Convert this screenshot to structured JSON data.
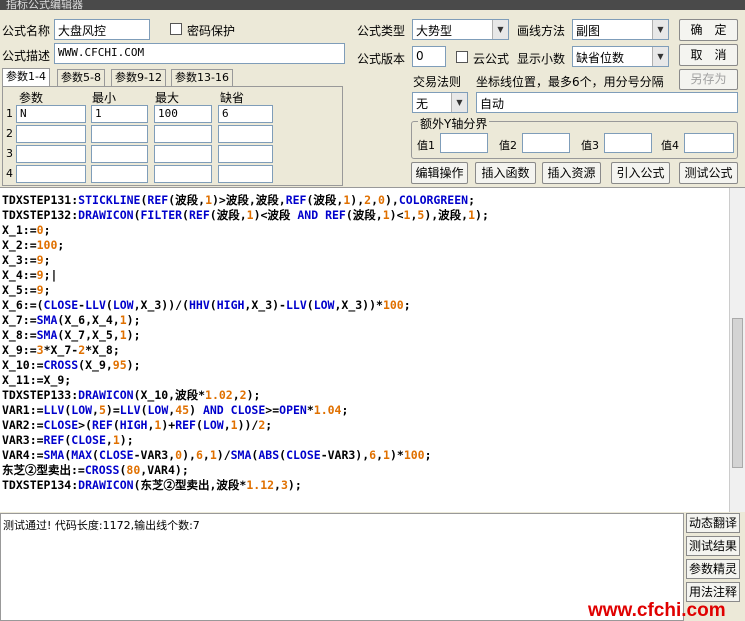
{
  "window": {
    "title": "指标公式编辑器"
  },
  "form": {
    "name_label": "公式名称",
    "name_value": "大盘风控",
    "password_label": "密码保护",
    "type_label": "公式类型",
    "type_value": "大势型",
    "draw_label": "画线方法",
    "draw_value": "副图",
    "desc_label": "公式描述",
    "desc_value": "WWW.CFCHI.COM",
    "version_label": "公式版本",
    "version_value": "0",
    "cloud_label": "云公式",
    "decimal_label": "显示小数",
    "decimal_value": "缺省位数",
    "trade_rule_label": "交易法则",
    "trade_rule_value": "无",
    "axis_label": "坐标线位置，最多6个，用分号分隔",
    "axis_value": "自动",
    "y_axis_group": "额外Y轴分界",
    "y_values": [
      "值1",
      "值2",
      "值3",
      "值4"
    ]
  },
  "buttons": {
    "ok": "确　定",
    "cancel": "取　消",
    "save_as": "另存为",
    "edit": "编辑操作",
    "insert_func": "插入函数",
    "insert_res": "插入资源",
    "import": "引入公式",
    "test": "测试公式"
  },
  "tabs": [
    "参数1-4",
    "参数5-8",
    "参数9-12",
    "参数13-16"
  ],
  "params": {
    "headers": [
      "参数",
      "最小",
      "最大",
      "缺省"
    ],
    "rows": [
      {
        "num": "1",
        "name": "N",
        "min": "1",
        "max": "100",
        "def": "6"
      },
      {
        "num": "2",
        "name": "",
        "min": "",
        "max": "",
        "def": ""
      },
      {
        "num": "3",
        "name": "",
        "min": "",
        "max": "",
        "def": ""
      },
      {
        "num": "4",
        "name": "",
        "min": "",
        "max": "",
        "def": ""
      }
    ]
  },
  "code_lines": [
    [
      [
        "TDXSTEP131:",
        "k"
      ],
      [
        "STICKLINE",
        "f"
      ],
      [
        "(",
        "k"
      ],
      [
        "REF",
        "f"
      ],
      [
        "(波段,",
        "k"
      ],
      [
        "1",
        "n"
      ],
      [
        ")>波段,波段,",
        "k"
      ],
      [
        "REF",
        "f"
      ],
      [
        "(波段,",
        "k"
      ],
      [
        "1",
        "n"
      ],
      [
        "),",
        "k"
      ],
      [
        "2",
        "n"
      ],
      [
        ",",
        "k"
      ],
      [
        "0",
        "n"
      ],
      [
        "),",
        "k"
      ],
      [
        "COLORGREEN",
        "f"
      ],
      [
        ";",
        "k"
      ]
    ],
    [
      [
        "TDXSTEP132:",
        "k"
      ],
      [
        "DRAWICON",
        "f"
      ],
      [
        "(",
        "k"
      ],
      [
        "FILTER",
        "f"
      ],
      [
        "(",
        "k"
      ],
      [
        "REF",
        "f"
      ],
      [
        "(波段,",
        "k"
      ],
      [
        "1",
        "n"
      ],
      [
        ")<波段 ",
        "k"
      ],
      [
        "AND",
        "f"
      ],
      [
        " ",
        "k"
      ],
      [
        "REF",
        "f"
      ],
      [
        "(波段,",
        "k"
      ],
      [
        "1",
        "n"
      ],
      [
        ")<",
        "k"
      ],
      [
        "1",
        "n"
      ],
      [
        ",",
        "k"
      ],
      [
        "5",
        "n"
      ],
      [
        "),波段,",
        "k"
      ],
      [
        "1",
        "n"
      ],
      [
        ");",
        "k"
      ]
    ],
    [
      [
        "X_1:=",
        "k"
      ],
      [
        "0",
        "n"
      ],
      [
        ";",
        "k"
      ]
    ],
    [
      [
        "X_2:=",
        "k"
      ],
      [
        "100",
        "n"
      ],
      [
        ";",
        "k"
      ]
    ],
    [
      [
        "X_3:=",
        "k"
      ],
      [
        "9",
        "n"
      ],
      [
        ";",
        "k"
      ]
    ],
    [
      [
        "X_4:=",
        "k"
      ],
      [
        "9",
        "n"
      ],
      [
        ";|",
        "k"
      ]
    ],
    [
      [
        "X_5:=",
        "k"
      ],
      [
        "9",
        "n"
      ],
      [
        ";",
        "k"
      ]
    ],
    [
      [
        "X_6:=(",
        "k"
      ],
      [
        "CLOSE",
        "f"
      ],
      [
        "-",
        "k"
      ],
      [
        "LLV",
        "f"
      ],
      [
        "(",
        "k"
      ],
      [
        "LOW",
        "f"
      ],
      [
        ",X_3))/(",
        "k"
      ],
      [
        "HHV",
        "f"
      ],
      [
        "(",
        "k"
      ],
      [
        "HIGH",
        "f"
      ],
      [
        ",X_3)-",
        "k"
      ],
      [
        "LLV",
        "f"
      ],
      [
        "(",
        "k"
      ],
      [
        "LOW",
        "f"
      ],
      [
        ",X_3))*",
        "k"
      ],
      [
        "100",
        "n"
      ],
      [
        ";",
        "k"
      ]
    ],
    [
      [
        "X_7:=",
        "k"
      ],
      [
        "SMA",
        "f"
      ],
      [
        "(X_6,X_4,",
        "k"
      ],
      [
        "1",
        "n"
      ],
      [
        ");",
        "k"
      ]
    ],
    [
      [
        "X_8:=",
        "k"
      ],
      [
        "SMA",
        "f"
      ],
      [
        "(X_7,X_5,",
        "k"
      ],
      [
        "1",
        "n"
      ],
      [
        ");",
        "k"
      ]
    ],
    [
      [
        "X_9:=",
        "k"
      ],
      [
        "3",
        "n"
      ],
      [
        "*X_7-",
        "k"
      ],
      [
        "2",
        "n"
      ],
      [
        "*X_8;",
        "k"
      ]
    ],
    [
      [
        "X_10:=",
        "k"
      ],
      [
        "CROSS",
        "f"
      ],
      [
        "(X_9,",
        "k"
      ],
      [
        "95",
        "n"
      ],
      [
        ");",
        "k"
      ]
    ],
    [
      [
        "X_11:=X_9;",
        "k"
      ]
    ],
    [
      [
        "TDXSTEP133:",
        "k"
      ],
      [
        "DRAWICON",
        "f"
      ],
      [
        "(X_10,波段*",
        "k"
      ],
      [
        "1.02",
        "n"
      ],
      [
        ",",
        "k"
      ],
      [
        "2",
        "n"
      ],
      [
        ");",
        "k"
      ]
    ],
    [
      [
        "VAR1:=",
        "k"
      ],
      [
        "LLV",
        "f"
      ],
      [
        "(",
        "k"
      ],
      [
        "LOW",
        "f"
      ],
      [
        ",",
        "k"
      ],
      [
        "5",
        "n"
      ],
      [
        ")=",
        "k"
      ],
      [
        "LLV",
        "f"
      ],
      [
        "(",
        "k"
      ],
      [
        "LOW",
        "f"
      ],
      [
        ",",
        "k"
      ],
      [
        "45",
        "n"
      ],
      [
        ") ",
        "k"
      ],
      [
        "AND",
        "f"
      ],
      [
        " ",
        "k"
      ],
      [
        "CLOSE",
        "f"
      ],
      [
        ">=",
        "k"
      ],
      [
        "OPEN",
        "f"
      ],
      [
        "*",
        "k"
      ],
      [
        "1.04",
        "n"
      ],
      [
        ";",
        "k"
      ]
    ],
    [
      [
        "VAR2:=",
        "k"
      ],
      [
        "CLOSE",
        "f"
      ],
      [
        ">(",
        "k"
      ],
      [
        "REF",
        "f"
      ],
      [
        "(",
        "k"
      ],
      [
        "HIGH",
        "f"
      ],
      [
        ",",
        "k"
      ],
      [
        "1",
        "n"
      ],
      [
        ")+",
        "k"
      ],
      [
        "REF",
        "f"
      ],
      [
        "(",
        "k"
      ],
      [
        "LOW",
        "f"
      ],
      [
        ",",
        "k"
      ],
      [
        "1",
        "n"
      ],
      [
        "))/",
        "k"
      ],
      [
        "2",
        "n"
      ],
      [
        ";",
        "k"
      ]
    ],
    [
      [
        "VAR3:=",
        "k"
      ],
      [
        "REF",
        "f"
      ],
      [
        "(",
        "k"
      ],
      [
        "CLOSE",
        "f"
      ],
      [
        ",",
        "k"
      ],
      [
        "1",
        "n"
      ],
      [
        ");",
        "k"
      ]
    ],
    [
      [
        "VAR4:=",
        "k"
      ],
      [
        "SMA",
        "f"
      ],
      [
        "(",
        "k"
      ],
      [
        "MAX",
        "f"
      ],
      [
        "(",
        "k"
      ],
      [
        "CLOSE",
        "f"
      ],
      [
        "-VAR3,",
        "k"
      ],
      [
        "0",
        "n"
      ],
      [
        "),",
        "k"
      ],
      [
        "6",
        "n"
      ],
      [
        ",",
        "k"
      ],
      [
        "1",
        "n"
      ],
      [
        ")/",
        "k"
      ],
      [
        "SMA",
        "f"
      ],
      [
        "(",
        "k"
      ],
      [
        "ABS",
        "f"
      ],
      [
        "(",
        "k"
      ],
      [
        "CLOSE",
        "f"
      ],
      [
        "-VAR3),",
        "k"
      ],
      [
        "6",
        "n"
      ],
      [
        ",",
        "k"
      ],
      [
        "1",
        "n"
      ],
      [
        ")*",
        "k"
      ],
      [
        "100",
        "n"
      ],
      [
        ";",
        "k"
      ]
    ],
    [
      [
        "东芝②型卖出:=",
        "k"
      ],
      [
        "CROSS",
        "f"
      ],
      [
        "(",
        "k"
      ],
      [
        "80",
        "n"
      ],
      [
        ",VAR4);",
        "k"
      ]
    ],
    [
      [
        "TDXSTEP134:",
        "k"
      ],
      [
        "DRAWICON",
        "f"
      ],
      [
        "(东芝②型卖出,波段*",
        "k"
      ],
      [
        "1.12",
        "n"
      ],
      [
        ",",
        "k"
      ],
      [
        "3",
        "n"
      ],
      [
        ");",
        "k"
      ]
    ]
  ],
  "code_colors": {
    "k": "#000000",
    "f": "#0000cc",
    "n": "#e07000"
  },
  "status": {
    "text": "测试通过! 代码长度:1172,输出线个数:7"
  },
  "side_buttons": [
    "动态翻译",
    "测试结果",
    "参数精灵",
    "用法注释"
  ],
  "watermark": "www.cfchi.com"
}
